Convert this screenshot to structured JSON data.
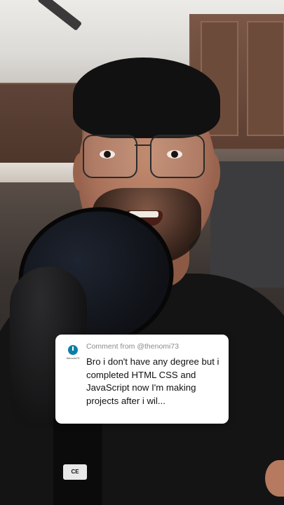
{
  "comment": {
    "meta": "Comment from @thenomi73",
    "text": "Bro i don't have any degree but i completed HTML CSS and JavaScript now I'm making projects after i wil...",
    "avatar_label": "thenomi73"
  },
  "mic": {
    "badge_text": "CE"
  },
  "colors": {
    "card_background": "#ffffff",
    "meta_text": "#8a8a8a",
    "body_text": "#111111",
    "avatar_accent": "#0a7fa8"
  }
}
